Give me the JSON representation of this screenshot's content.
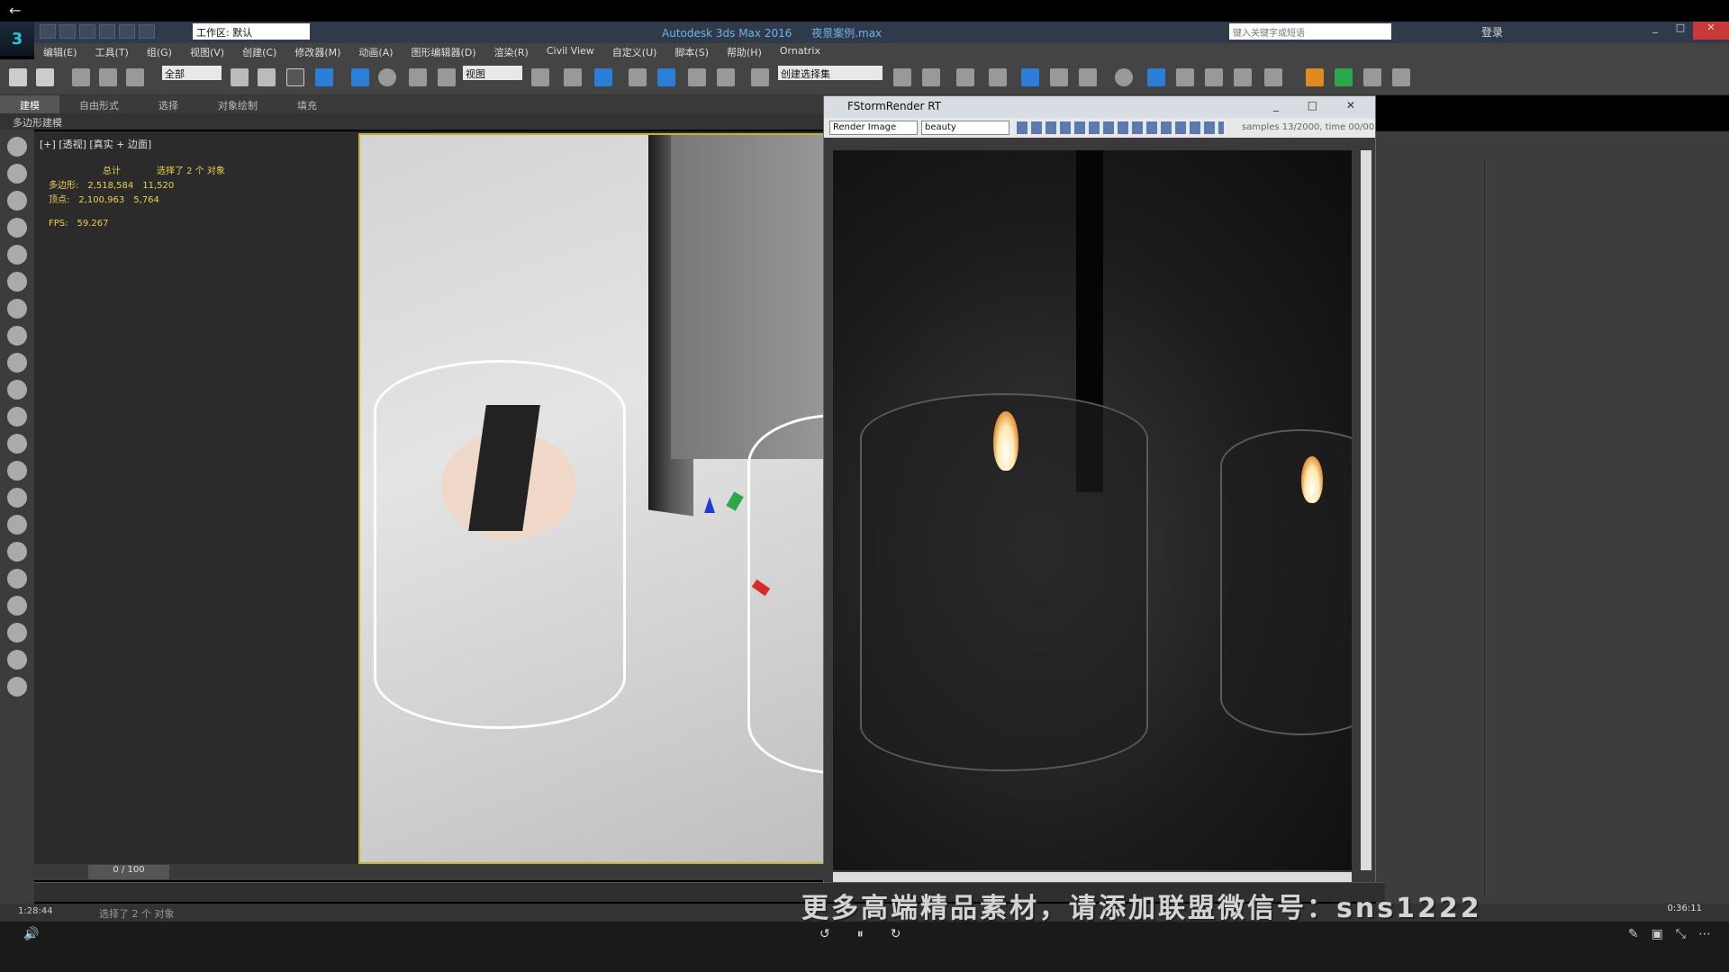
{
  "window": {
    "title": "Autodesk 3ds Max 2016",
    "file": "夜景案例.max",
    "workspace": "工作区: 默认",
    "search_placeholder": "键入关键字或短语",
    "login": "登录"
  },
  "menu": [
    "编辑(E)",
    "工具(T)",
    "组(G)",
    "视图(V)",
    "创建(C)",
    "修改器(M)",
    "动画(A)",
    "图形编辑器(D)",
    "渲染(R)",
    "Civil View",
    "自定义(U)",
    "脚本(S)",
    "帮助(H)",
    "Ornatrix"
  ],
  "toolbar": {
    "selection_filter": "全部",
    "ref_coord": "视图",
    "named_selection": "创建选择集"
  },
  "ribbon": {
    "tabs": [
      "建模",
      "自由形式",
      "选择",
      "对象绘制",
      "填充"
    ],
    "sub_label": "多边形建模"
  },
  "viewport": {
    "label": "[+] [透视] [真实 + 边面]",
    "stats_header_total": "总计",
    "stats_header_sel": "选择了 2 个 对象",
    "poly_label": "多边形:",
    "poly_total": "2,518,584",
    "poly_sel": "11,520",
    "vert_label": "顶点:",
    "vert_total": "2,100,963",
    "vert_sel": "5,764",
    "fps_label": "FPS:",
    "fps": "59.267"
  },
  "render_window": {
    "title": "FStormRender RT",
    "render_type": "Render Image",
    "channel": "beauty",
    "samples": "samples 13/2000,  time 00/00"
  },
  "timeline": {
    "position": "0 / 100"
  },
  "status": {
    "time": "1:28:44",
    "message": "选择了 2 个 对象",
    "clock": "0:36:11"
  },
  "watermark": "更多高端精品素材，请添加联盟微信号：sns1222"
}
